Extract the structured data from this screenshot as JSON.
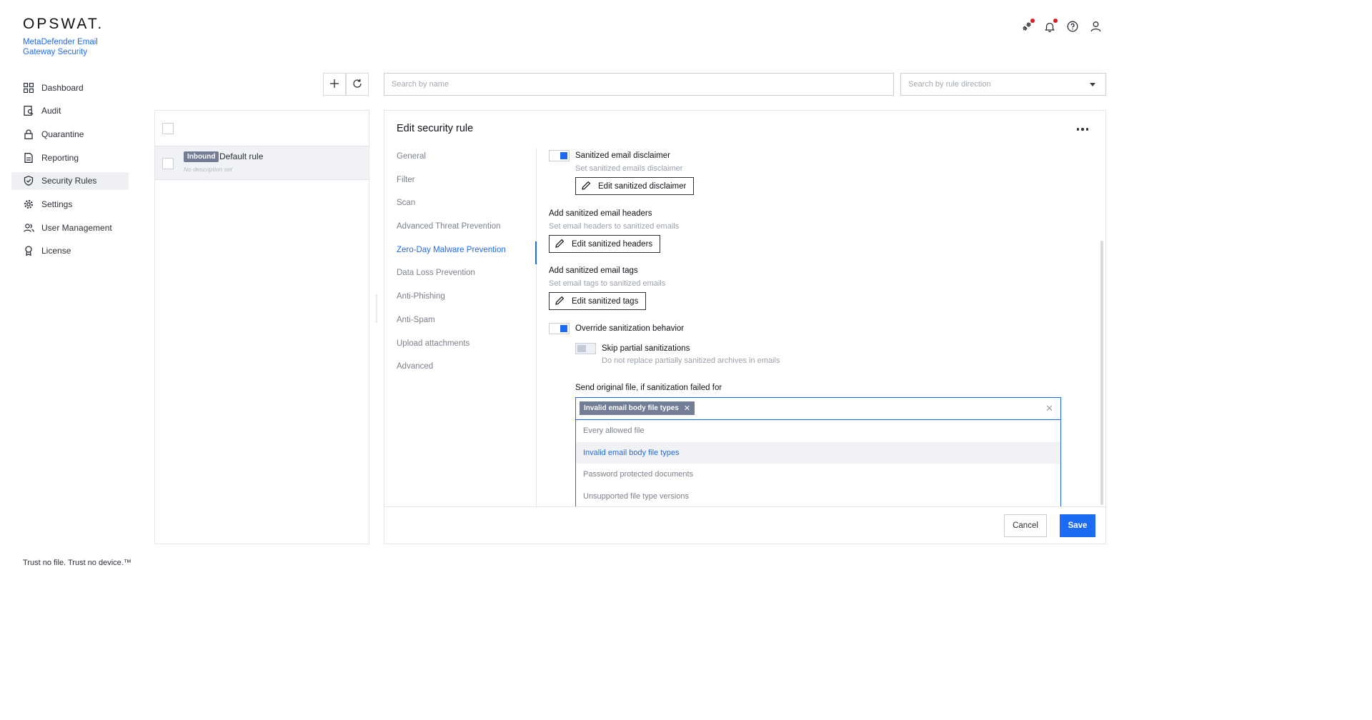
{
  "brand": {
    "logo": "OPSWAT.",
    "product": "MetaDefender Email Gateway Security"
  },
  "sidebar": {
    "items": [
      {
        "label": "Dashboard",
        "icon": "dashboard-icon"
      },
      {
        "label": "Audit",
        "icon": "audit-icon"
      },
      {
        "label": "Quarantine",
        "icon": "lock-icon"
      },
      {
        "label": "Reporting",
        "icon": "document-icon"
      },
      {
        "label": "Security Rules",
        "icon": "shield-check-icon",
        "active": true
      },
      {
        "label": "Settings",
        "icon": "gear-icon"
      },
      {
        "label": "User Management",
        "icon": "users-icon"
      },
      {
        "label": "License",
        "icon": "award-icon"
      }
    ]
  },
  "tagline": "Trust no file. Trust no device.™",
  "header": {
    "icons": [
      "integration-icon",
      "bell-icon",
      "help-icon",
      "user-icon"
    ]
  },
  "toolbar": {
    "add_icon": "plus-icon",
    "refresh_icon": "refresh-icon",
    "search_placeholder": "Search by name",
    "direction_placeholder": "Search by rule direction"
  },
  "rules": [
    {
      "direction": "Inbound",
      "name": "Default rule",
      "description": "No description set"
    }
  ],
  "editor": {
    "title": "Edit security rule",
    "tabs": [
      "General",
      "Filter",
      "Scan",
      "Advanced Threat Prevention",
      "Zero-Day Malware Prevention",
      "Data Loss Prevention",
      "Anti-Phishing",
      "Anti-Spam",
      "Upload attachments",
      "Advanced"
    ],
    "active_tab": "Zero-Day Malware Prevention",
    "disclaimer": {
      "label": "Sanitized email disclaimer",
      "hint": "Set sanitized emails disclaimer",
      "button": "Edit sanitized disclaimer",
      "enabled": true
    },
    "headers": {
      "label": "Add sanitized email headers",
      "hint": "Set email headers to sanitized emails",
      "button": "Edit sanitized headers"
    },
    "tags": {
      "label": "Add sanitized email tags",
      "hint": "Set email tags to sanitized emails",
      "button": "Edit sanitized tags"
    },
    "override": {
      "label": "Override sanitization behavior",
      "enabled": true
    },
    "skip_partial": {
      "label": "Skip partial sanitizations",
      "hint": "Do not replace partially sanitized archives in emails",
      "enabled": false
    },
    "send_original": {
      "label": "Send original file, if sanitization failed for",
      "selected": [
        "Invalid email body file types"
      ],
      "options": [
        "Every allowed file",
        "Invalid email body file types",
        "Password protected documents",
        "Unsupported file type versions"
      ]
    },
    "cancel_label": "Cancel",
    "save_label": "Save"
  },
  "colors": {
    "accent": "#1d6bf3",
    "badge": "#727d96",
    "notification_dot": "#e01b1b"
  }
}
